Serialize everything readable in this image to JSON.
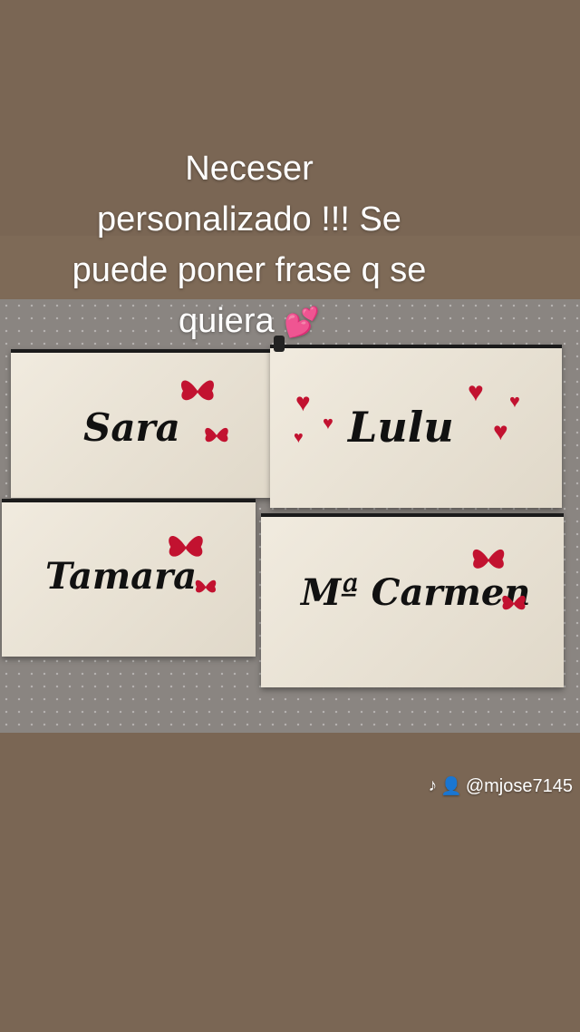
{
  "caption": {
    "line1": "Neceser",
    "line2": "personalizado !!! Se",
    "line3": "puede poner frase q se",
    "line4": "quiera",
    "emoji": "💕"
  },
  "bags": [
    {
      "name": "Sara"
    },
    {
      "name": "Lulu"
    },
    {
      "name": "Tamara"
    },
    {
      "name": "Mª Carmen"
    }
  ],
  "credit": {
    "handle": "@mjose7145",
    "platform_icon": "tiktok-icon",
    "user_icon": "user-icon"
  },
  "colors": {
    "background": "#7a6654",
    "decoration_red": "#c21230",
    "bag_canvas": "#ece4d4"
  }
}
